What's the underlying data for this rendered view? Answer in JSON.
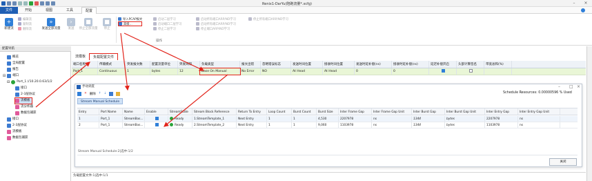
{
  "window": {
    "title": "Renix1-DarYu(陪跑流量*.xcfg)",
    "minimize": "–",
    "close": "×"
  },
  "menu": {
    "tabs": [
      "文件",
      "开始",
      "视图",
      "工具",
      "配置"
    ]
  },
  "ribbon": {
    "new_stream": "新建流",
    "edit_stream": "编辑流",
    "copy_stream": "复制流",
    "delete_stream": "删除流",
    "send_all": "发送全部流量",
    "send": "发送",
    "stop_all": "停止全部流量",
    "stop": "停止",
    "import_pcap": "导入PCAP报文",
    "advanced": "高级...",
    "small1": "启动二层学习",
    "small2": "启动端口二层学习",
    "small3": "停止二层学习",
    "small4": "启动所有端口ARP/ND学习",
    "small5": "启动所有端口ARP/ND学习",
    "small6": "停止端口ARP/ND学习",
    "small7": "停止所有端口ARP/ND学习",
    "group_label": "操作"
  },
  "nav": {
    "header": "配置导航",
    "items": [
      {
        "label": "概览",
        "color": "#3c7bd1"
      },
      {
        "label": "全局配置",
        "color": "#3c7bd1"
      },
      {
        "label": "报告",
        "color": "#3c7bd1"
      },
      {
        "label": "端口",
        "color": "#3c7bd1"
      },
      {
        "label": "Port_1 //10.20.0.63/1/2",
        "color": "#2aa33a"
      },
      {
        "label": "接口",
        "color": "#3c7bd1"
      },
      {
        "label": "2-3层协议",
        "color": "#3c7bd1"
      },
      {
        "label": "流模板",
        "color": "#e05a9b"
      },
      {
        "label": "流分析器",
        "color": "#e05a9b"
      },
      {
        "label": "数据包捕获",
        "color": "#e05a9b"
      },
      {
        "label": "接口",
        "color": "#3c7bd1"
      },
      {
        "label": "2-3层协议",
        "color": "#3c7bd1"
      },
      {
        "label": "流模板",
        "color": "#e05a9b"
      },
      {
        "label": "数据包捕获",
        "color": "#e05a9b"
      }
    ]
  },
  "content": {
    "tabs": [
      "流模板",
      "负载配置文件"
    ],
    "columns": [
      "端口名称",
      "传输模式",
      "突发报文数",
      "配置流量单位",
      "突发间隔",
      "负载类型",
      "报文出错",
      "忽略错误标志",
      "发送时间位置",
      "接收时间位置",
      "发送时延补偿(ns)",
      "接收时延补偿(ns)",
      "延迟补偿开启",
      "头部计算签名",
      "带宽总和(%)"
    ],
    "row": [
      "Port_1",
      "Continuous",
      "1",
      "bytes",
      "12",
      "Base On Manual",
      "No Error",
      "NO",
      "At Head",
      "At Head",
      "0",
      "0",
      "",
      "",
      ""
    ],
    "status": "负载配置文件:1|选中:1/1"
  },
  "dialog": {
    "title": "手动调度",
    "toolbar_delete": "删除",
    "resources_label": "Schedule Resources:",
    "resources_value": "0.00000596",
    "resources_unit": "% Used",
    "tab": "Stream Manual Schedule",
    "columns": [
      "Entry",
      "Port Name",
      "Name",
      "Enable",
      "StreamState",
      "Stream Block Reference",
      "Return To Entry",
      "Loop Count",
      "Burst Count",
      "Burst Size",
      "Inter Frame Gap",
      "Inter Frame Gap Unit",
      "Inter Burst Gap",
      "Inter Burst Gap Unit",
      "Inter Entry Gap",
      "Inter Entry Gap Unit"
    ],
    "rows": [
      [
        "1",
        "Port_1",
        "StreamBas...",
        "",
        "Ready",
        "1.StreamTemplate_1",
        "Next Entry",
        "1",
        "1",
        "4,530",
        "2207978",
        "ns",
        "1344",
        "bytes",
        "2207978",
        "ns"
      ],
      [
        "2",
        "Port_1",
        "StreamBas...",
        "",
        "Ready",
        "2.StreamTemplate_2",
        "Next Entry",
        "1",
        "1",
        "9,060",
        "1103978",
        "ns",
        "1344",
        "bytes",
        "1103978",
        "ns"
      ]
    ],
    "status": "Stream Manual Schedule:2|选中:1/2",
    "close_button": "关闭"
  }
}
